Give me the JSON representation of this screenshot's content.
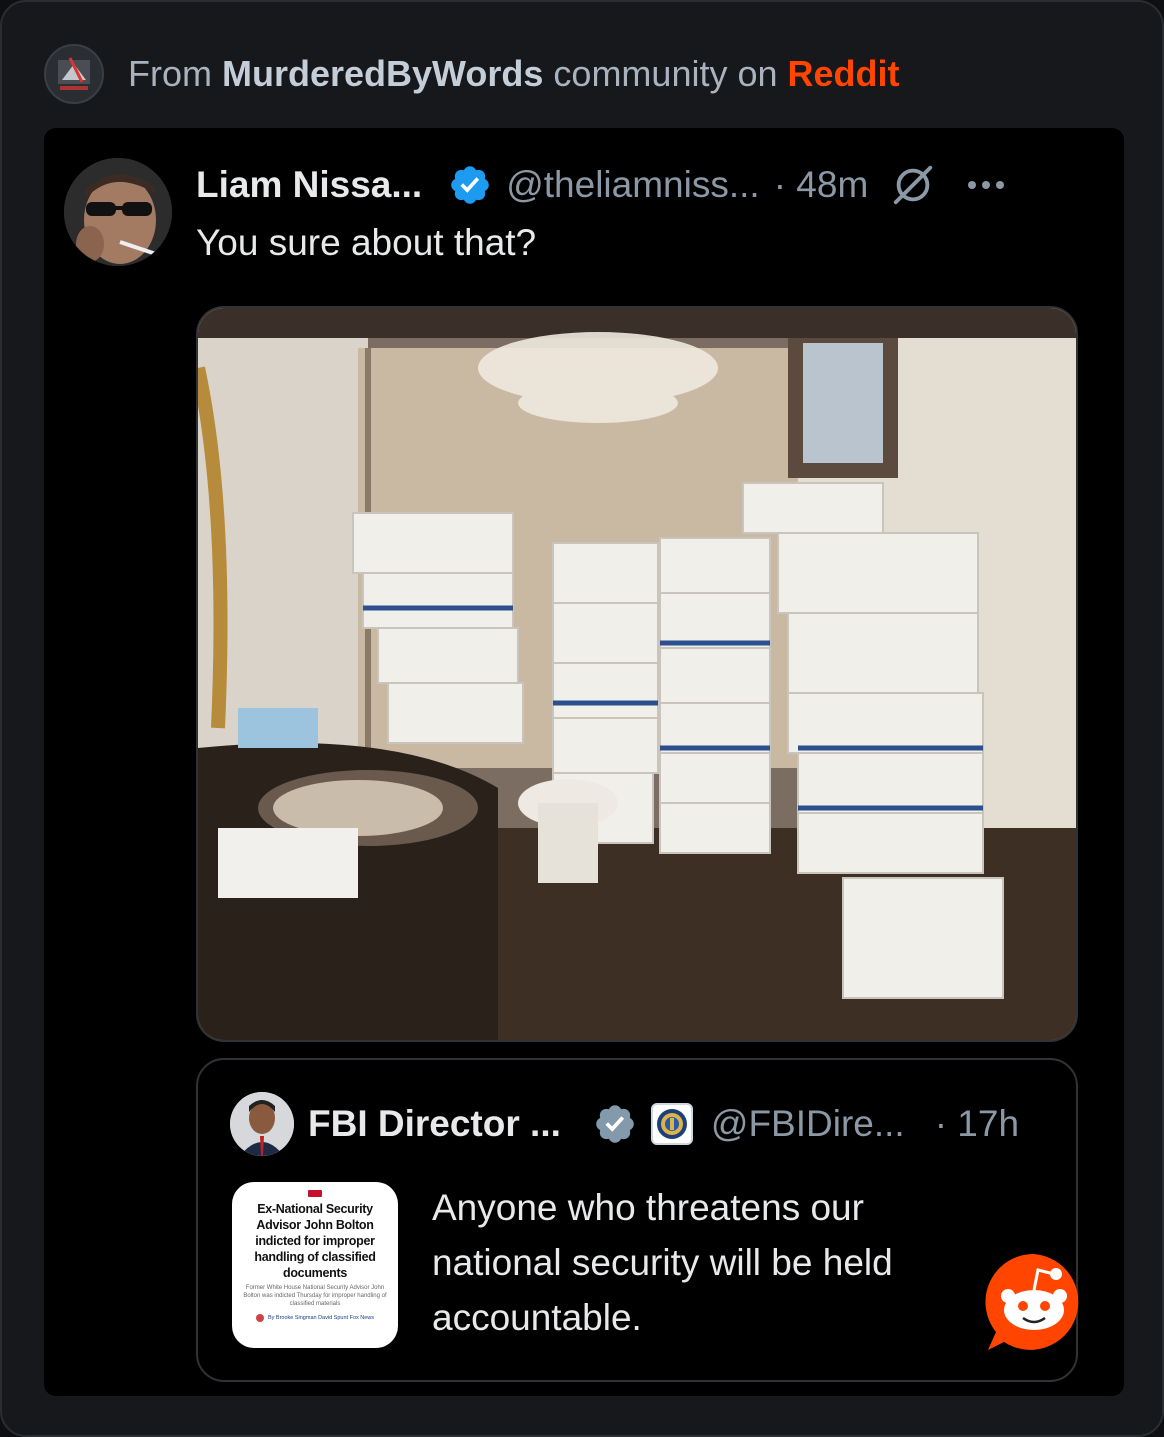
{
  "source": {
    "prefix": "From",
    "community": "MurderedByWords",
    "middle": "community on",
    "platform": "Reddit"
  },
  "tweet": {
    "author_name": "Liam Nissa...",
    "handle": "@theliamniss...",
    "time": "· 48m",
    "text": "You sure about that?"
  },
  "quote": {
    "author_name": "FBI Director ...",
    "handle": "@FBIDire...",
    "time": "· 17h",
    "text": "Anyone who threatens our national security will be held accountable.",
    "thumbnail": {
      "headline": "Ex-National Security Advisor John Bolton indicted for improper handling of classified documents",
      "sub": "Former White House National Security Advisor John Bolton was indicted Thursday for improper handling of classified materials",
      "byline": "By Brooke Singman  David Spunt  Fox News"
    }
  },
  "colors": {
    "accent_reddit": "#ff4500",
    "verified_blue": "#1d9bf0",
    "muted": "#8b98a5"
  },
  "icons": [
    "community-avatar-icon",
    "verified-badge-icon",
    "grok-icon",
    "more-icon",
    "fbi-seal-icon",
    "reddit-snoo-icon"
  ]
}
